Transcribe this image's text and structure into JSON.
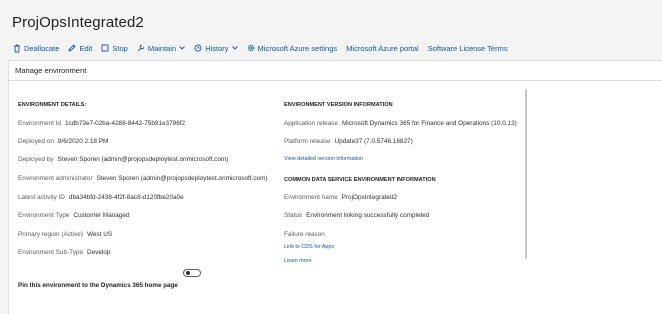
{
  "page": {
    "title": "ProjOpsIntegrated2"
  },
  "toolbar": {
    "items": [
      {
        "label": "Deallocate",
        "icon": "trash-icon"
      },
      {
        "label": "Edit",
        "icon": "pencil-icon"
      },
      {
        "label": "Stop",
        "icon": "stop-icon"
      },
      {
        "label": "Maintain",
        "icon": "wrench-icon"
      },
      {
        "label": "History",
        "icon": "history-icon"
      },
      {
        "label": "Microsoft Azure settings",
        "icon": "gear-icon"
      },
      {
        "label": "Microsoft Azure portal",
        "icon": ""
      },
      {
        "label": "Software License Terms",
        "icon": ""
      }
    ]
  },
  "panel": {
    "title": "Manage environment"
  },
  "environment_details": {
    "heading": "ENVIRONMENT DETAILS:",
    "rows": [
      {
        "label": "Environment Id",
        "value": "1cdb73e7-02ba-4288-8442-75b91e3796f2"
      },
      {
        "label": "Deployed on",
        "value": "8/6/2020 2:18 PM"
      },
      {
        "label": "Deployed by",
        "value": "Steven Sporen (admin@projopsdeploytest.onmicrosoft.com)"
      },
      {
        "label": "Environment administrator",
        "value": "Steven Sporen (admin@projopsdeploytest.onmicrosoft.com)"
      },
      {
        "label": "Latest activity ID",
        "value": "dba34bfd-2438-4f2f-8ac8-d120fbe20a0e"
      },
      {
        "label": "Environment Type",
        "value": "Customer Managed"
      },
      {
        "label": "Primary region (Active)",
        "value": "West US"
      },
      {
        "label": "Environment Sub-Type",
        "value": "Develop"
      }
    ]
  },
  "version_info": {
    "heading": "ENVIRONMENT VERSION INFORMATION",
    "rows": [
      {
        "label": "Application release",
        "value": "Microsoft Dynamics 365 for Finance and Operations (10.0.13)"
      },
      {
        "label": "Platform release",
        "value": "Update37 (7.0.5746.16827)"
      }
    ],
    "link": "View detailed version information"
  },
  "cds_info": {
    "heading": "COMMON DATA SERVICE ENVIRONMENT INFORMATION",
    "rows": [
      {
        "label": "Environment name",
        "value": "ProjOpsIntegrated2"
      },
      {
        "label": "Status",
        "value": "Environment linking successfully completed"
      },
      {
        "label": "Failure reason",
        "value": ""
      }
    ],
    "links": [
      "Link to CDS for Apps",
      "Learn more"
    ]
  },
  "pin": {
    "label": "Pin this environment to the Dynamics 365 home page",
    "enabled": false
  },
  "colors": {
    "accent": "#0f5aa8",
    "background": "#f4f4f4",
    "card": "#ffffff",
    "label": "#605e5c"
  }
}
